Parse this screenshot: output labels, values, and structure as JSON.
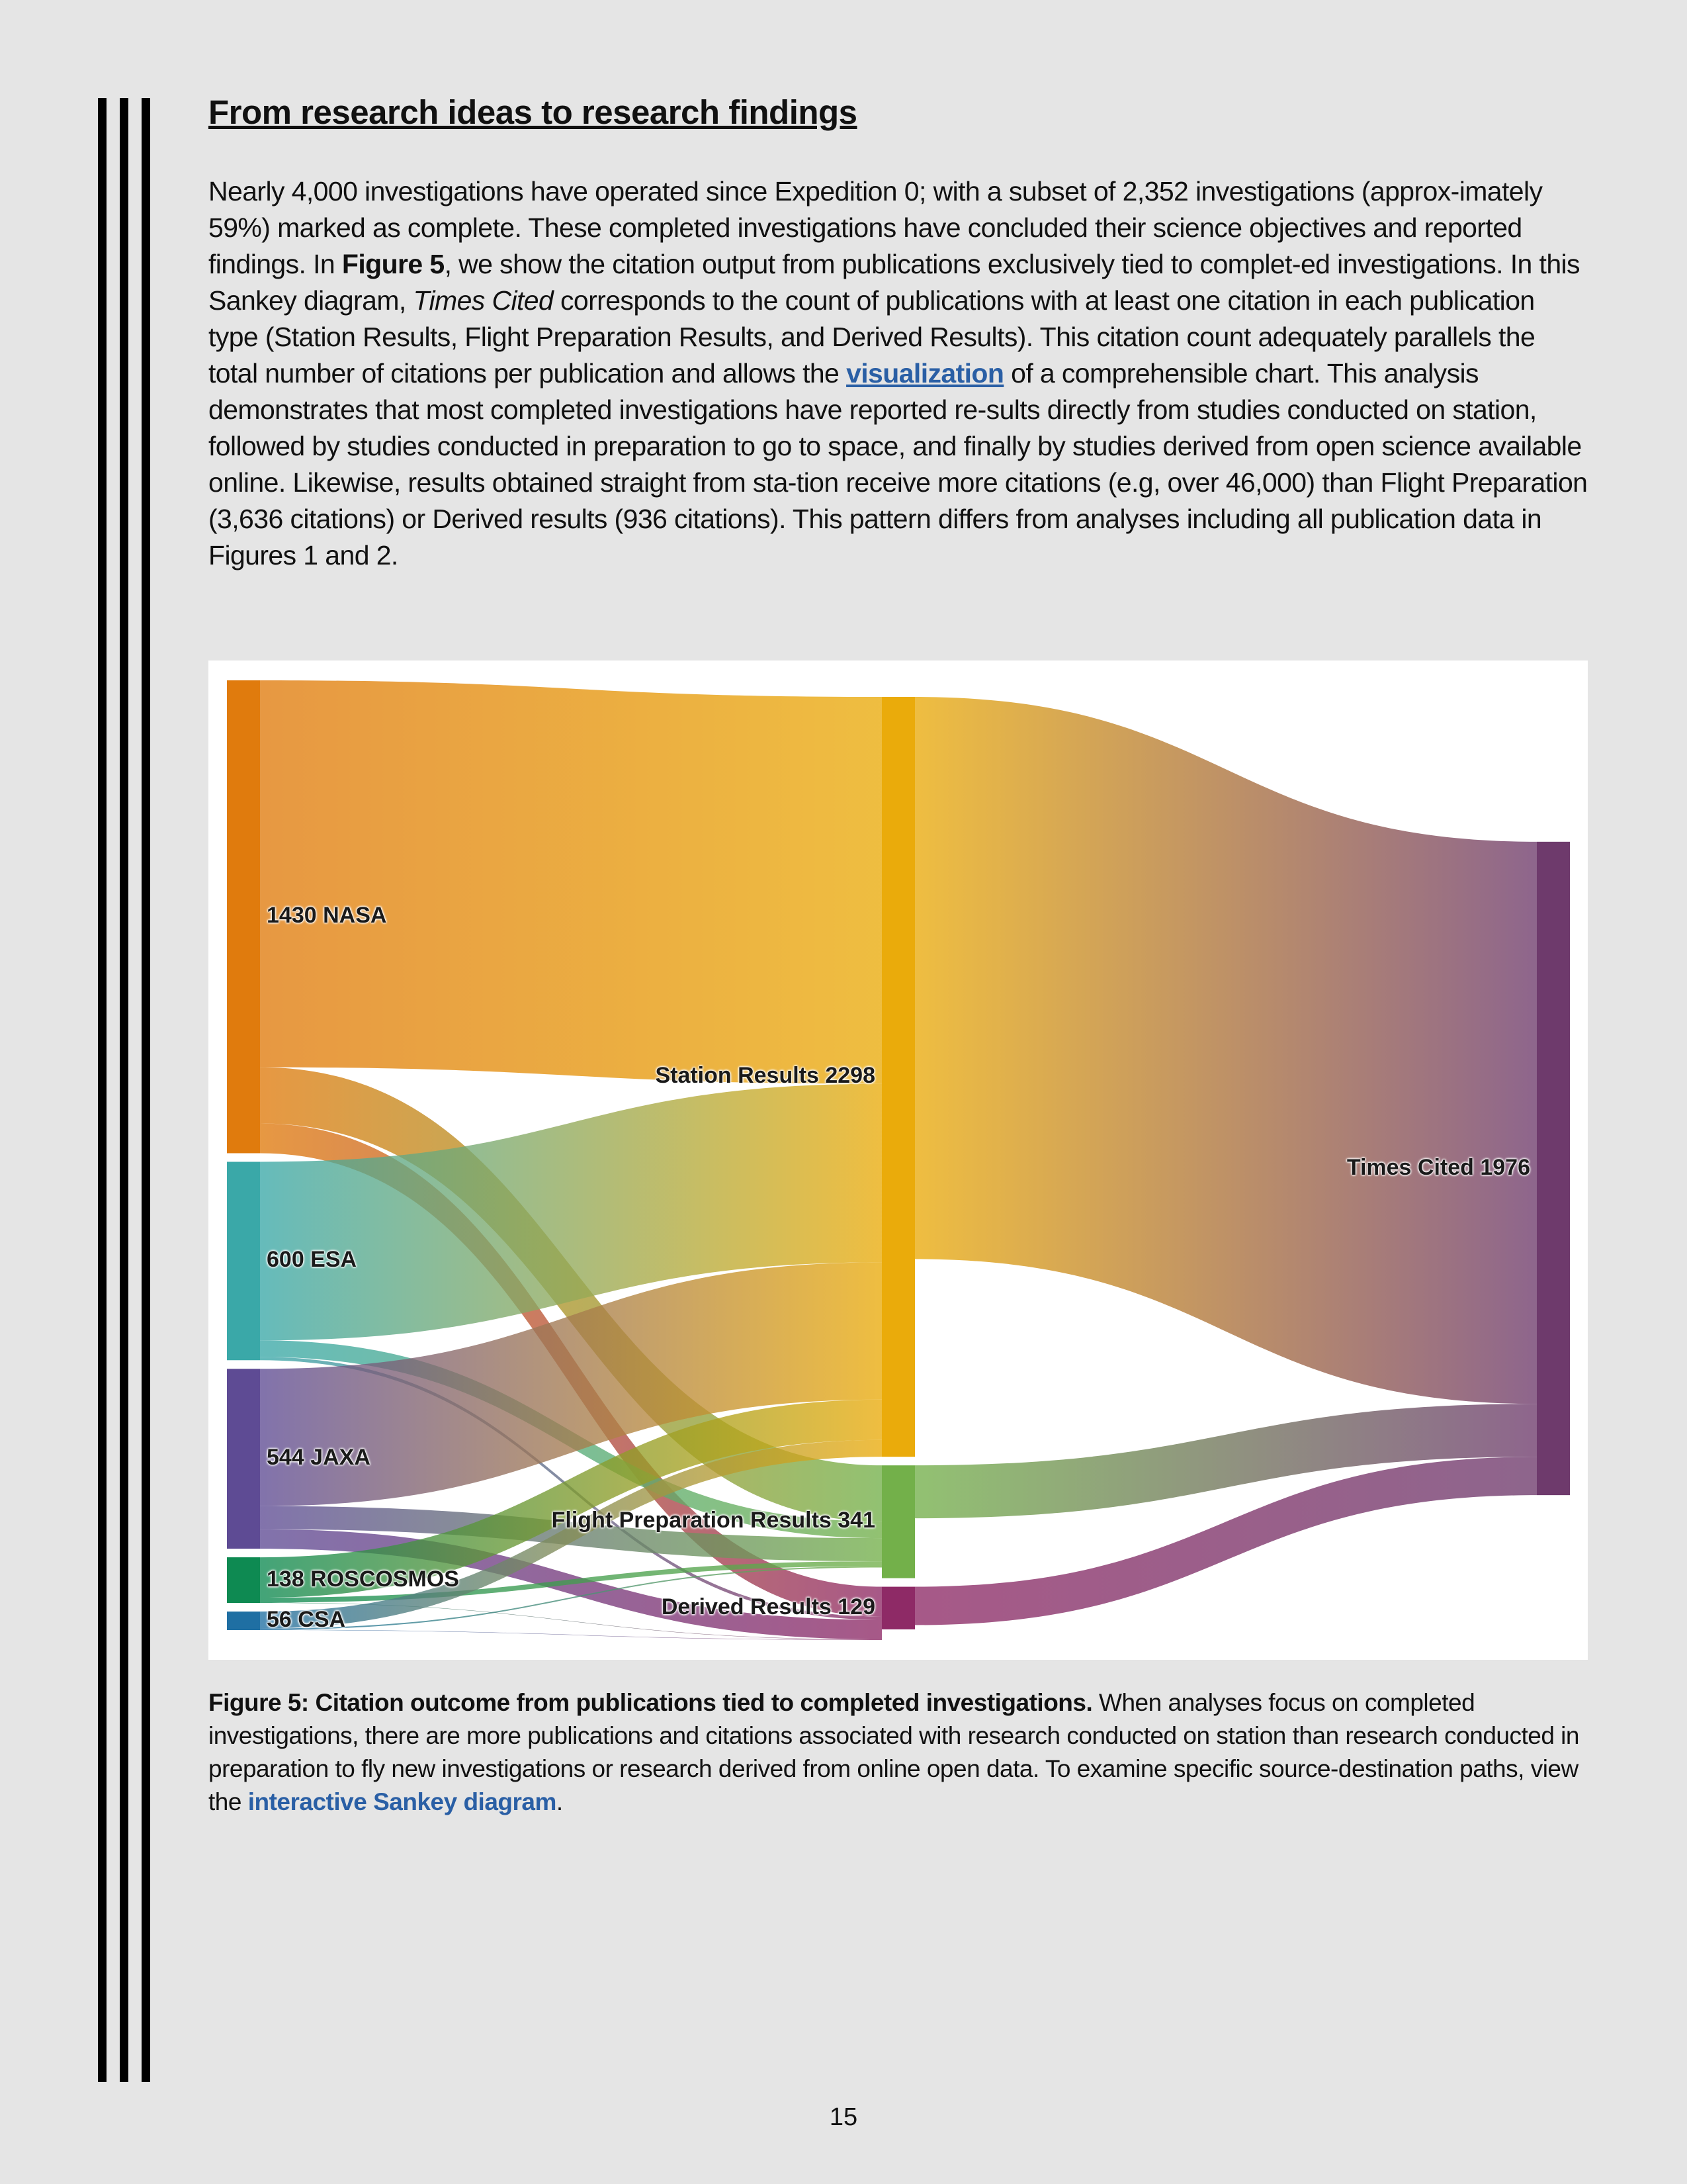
{
  "heading": "From research ideas to research findings",
  "body": {
    "p1": "Nearly 4,000 investigations have operated since Expedition 0; with a subset of 2,352 investigations (approx-imately 59%) marked as complete. These completed investigations have concluded their science objectives and reported findings. In ",
    "figure_ref": "Figure 5",
    "p2": ", we show the citation output from publications exclusively tied to complet-ed investigations. In this Sankey diagram, ",
    "times_cited_em": "Times Cited",
    "p3": " corresponds to the count of publications with at least one citation in each publication type (Station Results, Flight Preparation Results, and Derived Results). This citation count adequately parallels the total number of citations per publication and allows the ",
    "link_text": "visualization",
    "p4": " of a comprehensible chart. This analysis demonstrates that most completed investigations have reported re-sults directly from studies conducted on station, followed by studies conducted in preparation to go to space, and finally by studies derived from open science available online. Likewise, results obtained straight from sta-tion receive more citations (e.g, over 46,000) than Flight Preparation (3,636 citations) or Derived results (936 citations). This pattern differs from analyses including all publication data in Figures 1 and 2."
  },
  "figure": {
    "chart_data": {
      "type": "sankey",
      "nodes": [
        {
          "id": "NASA",
          "label": "1430 NASA",
          "value": 1430,
          "color": "#e07b0d"
        },
        {
          "id": "ESA",
          "label": "600 ESA",
          "value": 600,
          "color": "#3aa8a8"
        },
        {
          "id": "JAXA",
          "label": "544 JAXA",
          "value": 544,
          "color": "#5e4b94"
        },
        {
          "id": "ROSCOSMOS",
          "label": "138 ROSCOSMOS",
          "value": 138,
          "color": "#0e8a52"
        },
        {
          "id": "CSA",
          "label": "56 CSA",
          "value": 56,
          "color": "#1f6fa3"
        },
        {
          "id": "Station",
          "label": "Station Results 2298",
          "value": 2298,
          "color": "#eaab0b"
        },
        {
          "id": "FlightPrep",
          "label": "Flight Preparation Results 341",
          "value": 341,
          "color": "#73b04a"
        },
        {
          "id": "Derived",
          "label": "Derived Results 129",
          "value": 129,
          "color": "#8e2a66"
        },
        {
          "id": "Cited",
          "label": "Times Cited 1976",
          "value": 1976,
          "color": "#6e3a6c"
        }
      ],
      "links": [
        {
          "source": "NASA",
          "target": "Station",
          "value": 1170
        },
        {
          "source": "NASA",
          "target": "FlightPrep",
          "value": 170
        },
        {
          "source": "NASA",
          "target": "Derived",
          "value": 90
        },
        {
          "source": "ESA",
          "target": "Station",
          "value": 540
        },
        {
          "source": "ESA",
          "target": "FlightPrep",
          "value": 50
        },
        {
          "source": "ESA",
          "target": "Derived",
          "value": 10
        },
        {
          "source": "JAXA",
          "target": "Station",
          "value": 415
        },
        {
          "source": "JAXA",
          "target": "FlightPrep",
          "value": 70
        },
        {
          "source": "JAXA",
          "target": "Derived",
          "value": 59
        },
        {
          "source": "ROSCOSMOS",
          "target": "Station",
          "value": 122
        },
        {
          "source": "ROSCOSMOS",
          "target": "FlightPrep",
          "value": 15
        },
        {
          "source": "ROSCOSMOS",
          "target": "Derived",
          "value": 1
        },
        {
          "source": "CSA",
          "target": "Station",
          "value": 51
        },
        {
          "source": "CSA",
          "target": "FlightPrep",
          "value": 4
        },
        {
          "source": "CSA",
          "target": "Derived",
          "value": 1
        },
        {
          "source": "Station",
          "target": "Cited",
          "value": 1700
        },
        {
          "source": "FlightPrep",
          "target": "Cited",
          "value": 160
        },
        {
          "source": "Derived",
          "target": "Cited",
          "value": 116
        }
      ]
    },
    "caption_bold": "Figure 5: Citation outcome from publications tied to completed investigations.",
    "caption_text": " When analyses focus on completed investigations, there are more publications and citations associated with research conducted on station than research conducted in preparation to fly new investigations or research derived from online open data. To examine specific source-destination paths, view the ",
    "caption_link": "interactive Sankey diagram",
    "caption_end": "."
  },
  "page_number": "15"
}
